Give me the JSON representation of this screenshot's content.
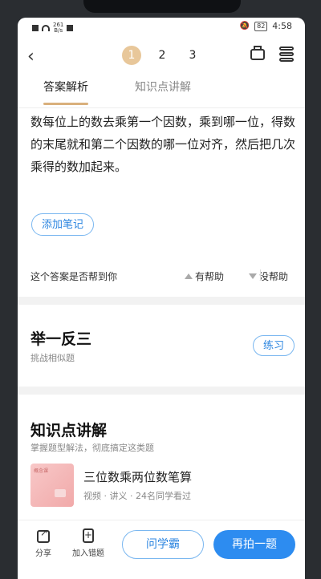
{
  "status": {
    "speed_top": "261",
    "speed_unit": "B/s",
    "battery": "82",
    "time": "4:58"
  },
  "header": {
    "back_glyph": "‹",
    "pages": [
      "1",
      "2",
      "3"
    ],
    "active_page": "1"
  },
  "tabs": [
    {
      "label": "答案解析"
    },
    {
      "label": "知识点讲解"
    }
  ],
  "answer": {
    "text": "数每位上的数去乘第一个因数，乘到哪一位，得数的末尾就和第二个因数的哪一位对齐，然后把几次乘得的数加起来。"
  },
  "note_button": "添加笔记",
  "feedback": {
    "question": "这个答案是否帮到你",
    "helpful": "有帮助",
    "not_helpful": "没帮助"
  },
  "practice_section": {
    "title": "举一反三",
    "subtitle": "挑战相似题",
    "button": "练习"
  },
  "knowledge_section": {
    "title": "知识点讲解",
    "subtitle": "掌握题型解法，彻底搞定这类题",
    "video": {
      "thumb_tag": "概念课",
      "title": "三位数乘两位数笔算",
      "meta": "视频 · 讲义 · 24名同学看过"
    }
  },
  "bottom_bar": {
    "share": "分享",
    "add_wrong": "加入错题",
    "ask": "问学霸",
    "retake": "再拍一题"
  },
  "colors": {
    "accent_blue": "#2d8cf0",
    "active_page": "#e8c79a",
    "tab_indicator": "#d9b07c"
  }
}
